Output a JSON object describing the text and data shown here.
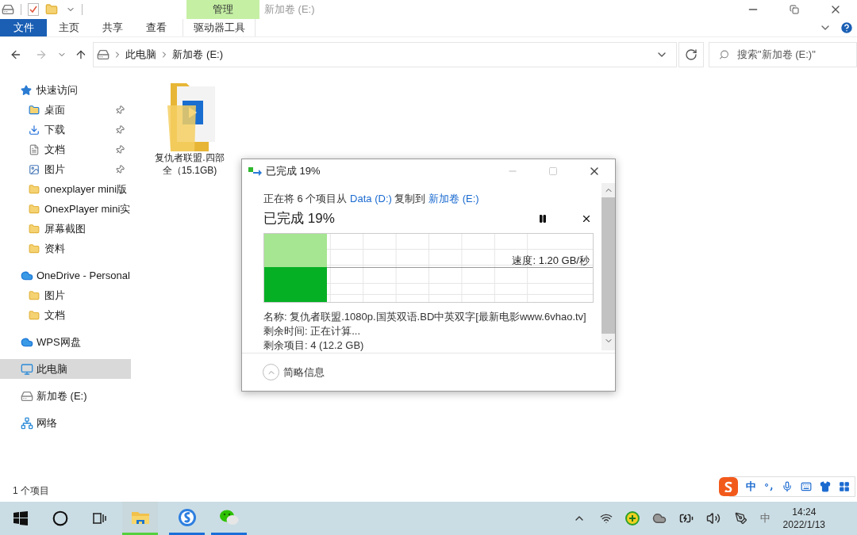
{
  "window": {
    "title": "新加卷 (E:)",
    "context_tab": "管理"
  },
  "ribbon_tabs": [
    {
      "label": "文件",
      "kind": "file"
    },
    {
      "label": "主页",
      "kind": "plain"
    },
    {
      "label": "共享",
      "kind": "plain"
    },
    {
      "label": "查看",
      "kind": "plain"
    },
    {
      "label": "驱动器工具",
      "kind": "context"
    }
  ],
  "address": {
    "breadcrumbs": [
      "此电脑",
      "新加卷 (E:)"
    ]
  },
  "search": {
    "placeholder": "搜索\"新加卷 (E:)\""
  },
  "sidebar": {
    "items": [
      {
        "label": "快速访问",
        "kind": "star",
        "selected": false,
        "children": [
          {
            "label": "桌面",
            "kind": "desktop",
            "pinned": true,
            "selected": false
          },
          {
            "label": "下载",
            "kind": "download",
            "pinned": true,
            "selected": false
          },
          {
            "label": "文档",
            "kind": "document",
            "pinned": true,
            "selected": false
          },
          {
            "label": "图片",
            "kind": "pictures",
            "pinned": true,
            "selected": false
          },
          {
            "label": "onexplayer mini版",
            "kind": "folder",
            "pinned": false,
            "selected": false
          },
          {
            "label": "OnexPlayer mini实",
            "kind": "folder",
            "pinned": false,
            "selected": false
          },
          {
            "label": "屏幕截图",
            "kind": "folder",
            "pinned": false,
            "selected": false
          },
          {
            "label": "资料",
            "kind": "folder",
            "pinned": false,
            "selected": false
          }
        ]
      },
      {
        "label": "OneDrive - Personal",
        "kind": "cloud",
        "selected": false,
        "children": [
          {
            "label": "图片",
            "kind": "folder",
            "pinned": false,
            "selected": false
          },
          {
            "label": "文档",
            "kind": "folder",
            "pinned": false,
            "selected": false
          }
        ]
      },
      {
        "label": "WPS网盘",
        "kind": "cloud",
        "selected": false
      },
      {
        "label": "此电脑",
        "kind": "computer",
        "selected": true
      },
      {
        "label": "新加卷 (E:)",
        "kind": "drive",
        "selected": false
      },
      {
        "label": "网络",
        "kind": "network",
        "selected": false
      }
    ]
  },
  "files": [
    {
      "name": "复仇者联盟.四部全（15.1GB)"
    }
  ],
  "status_bar": {
    "count": "1 个项目"
  },
  "copy_dialog": {
    "title": "已完成 19%",
    "prefix": "正在将 6 个项目从",
    "source": "Data (D:)",
    "middle": "复制到",
    "destination": "新加卷 (E:)",
    "heading": "已完成 19%",
    "level": 0.19,
    "speed": "速度: 1.20 GB/秒",
    "details": [
      {
        "label": "名称:",
        "value": "复仇者联盟.1080p.国英双语.BD中英双字[最新电影www.6vhao.tv]"
      },
      {
        "label": "剩余时间:",
        "value": "正在计算..."
      },
      {
        "label": "剩余项目:",
        "value": "4 (12.2 GB)"
      }
    ],
    "footer": "简略信息"
  },
  "ime_toolbar": {
    "mode": "中"
  },
  "taskbar": {
    "apps": [
      {
        "kind": "explorer",
        "active": true
      },
      {
        "kind": "sogou",
        "active": false
      },
      {
        "kind": "wechat",
        "active": false
      }
    ],
    "ime": "中",
    "time": "14:24",
    "date": "2022/1/13"
  }
}
